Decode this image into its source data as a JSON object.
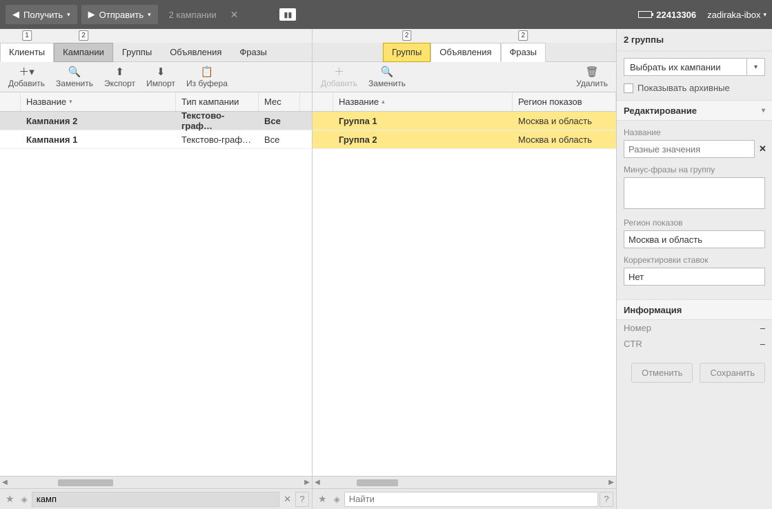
{
  "topbar": {
    "get_btn": "Получить",
    "send_btn": "Отправить",
    "campaigns_label": "2 кампании",
    "account_id": "22413306",
    "user": "zadiraka-ibox"
  },
  "left": {
    "tabs": [
      "Клиенты",
      "Кампании",
      "Группы",
      "Объявления",
      "Фразы"
    ],
    "badges": {
      "0": "1",
      "1": "2"
    },
    "active_tab": 1,
    "preactive_tab": 0,
    "toolbar": {
      "add": "Добавить",
      "replace": "Заменить",
      "export": "Экспорт",
      "import": "Импорт",
      "clipboard": "Из буфера"
    },
    "columns": {
      "name": "Название",
      "type": "Тип кампании",
      "place": "Мес"
    },
    "rows": [
      {
        "name": "Кампания 2",
        "type": "Текстово-граф…",
        "place": "Все"
      },
      {
        "name": "Кампания 1",
        "type": "Текстово-граф…",
        "place": "Все"
      }
    ],
    "search_value": "камп"
  },
  "middle": {
    "tabs": [
      "Группы",
      "Объявления",
      "Фразы"
    ],
    "badges": {
      "0": "2",
      "2": "2"
    },
    "active_tab": 0,
    "toolbar": {
      "add": "Добавить",
      "replace": "Заменить",
      "delete": "Удалить"
    },
    "columns": {
      "name": "Название",
      "region": "Регион показов"
    },
    "rows": [
      {
        "name": "Группа 1",
        "region": "Москва и область"
      },
      {
        "name": "Группа 2",
        "region": "Москва и область"
      }
    ],
    "search_placeholder": "Найти"
  },
  "right": {
    "header": "2 группы",
    "dropdown": "Выбрать их кампании",
    "show_archived": "Показывать архивные",
    "editing": {
      "title": "Редактирование",
      "name_label": "Название",
      "name_placeholder": "Разные значения",
      "minus_label": "Минус-фразы на группу",
      "region_label": "Регион показов",
      "region_value": "Москва и область",
      "bids_label": "Корректировки ставок",
      "bids_value": "Нет"
    },
    "info": {
      "title": "Информация",
      "number_label": "Номер",
      "number_value": "–",
      "ctr_label": "CTR",
      "ctr_value": "–"
    },
    "buttons": {
      "cancel": "Отменить",
      "save": "Сохранить"
    }
  }
}
